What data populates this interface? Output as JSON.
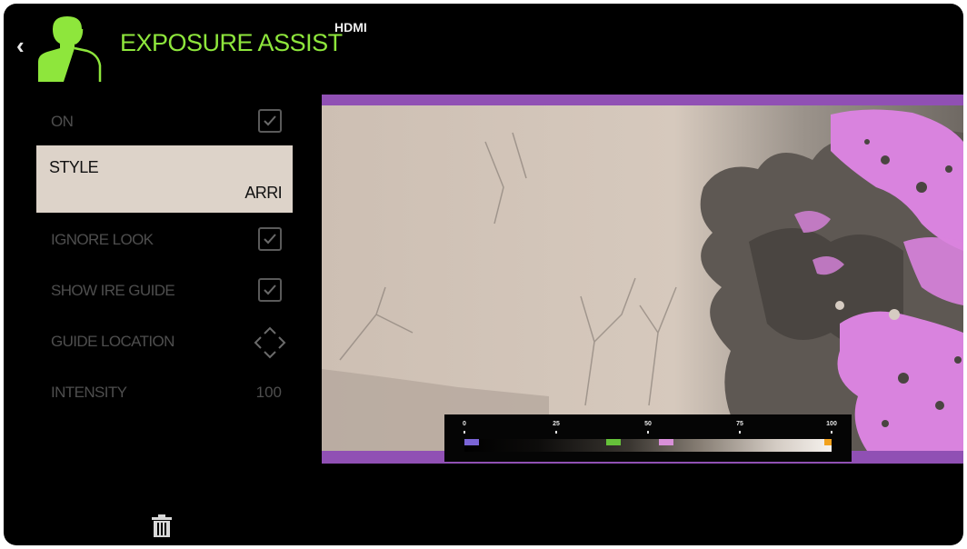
{
  "header": {
    "title": "EXPOSURE ASSIST",
    "source": "HDMI"
  },
  "settings": {
    "on": {
      "label": "ON",
      "checked": true
    },
    "style": {
      "label": "STYLE",
      "value": "ARRI",
      "selected": true
    },
    "ignore_look": {
      "label": "IGNORE LOOK",
      "checked": true
    },
    "show_ire_guide": {
      "label": "SHOW IRE GUIDE",
      "checked": true
    },
    "guide_location": {
      "label": "GUIDE LOCATION",
      "icon": "guide-location-icon"
    },
    "intensity": {
      "label": "INTENSITY",
      "value": "100"
    }
  },
  "ire_guide": {
    "ticks": [
      "0",
      "25",
      "50",
      "75",
      "100"
    ],
    "swatches": [
      {
        "name": "low",
        "color": "#7a64d6"
      },
      {
        "name": "mid",
        "color": "#66c23a"
      },
      {
        "name": "skin",
        "color": "#d890d8"
      },
      {
        "name": "high",
        "color": "#f2a21e"
      }
    ]
  },
  "colors": {
    "accent": "#8ee63c",
    "false_color_purple": "#9050b4",
    "false_color_pink": "#d983de",
    "selected_row": "#ddd3c9"
  },
  "icons": {
    "back": "chevron-left-icon",
    "header": "person-silhouette-icon",
    "delete": "trash-icon"
  }
}
